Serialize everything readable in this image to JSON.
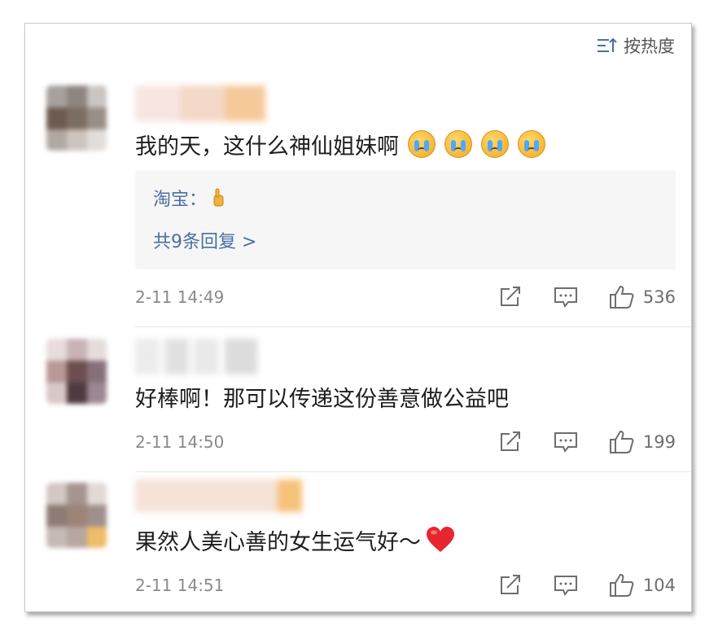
{
  "header": {
    "sort_label": "按热度"
  },
  "comments": [
    {
      "text": "我的天，这什么神仙姐妹啊",
      "emoji_count": 4,
      "replies": {
        "first_reply_user": "淘宝：",
        "more_label": "共9条回复 >"
      },
      "time": "2-11 14:49",
      "likes": "536"
    },
    {
      "text": "好棒啊！那可以传递这份善意做公益吧",
      "time": "2-11 14:50",
      "likes": "199"
    },
    {
      "text": "果然人美心善的女生运气好～",
      "time": "2-11 14:51",
      "likes": "104"
    }
  ],
  "colors": {
    "link": "#4a6fa0",
    "meta": "#8a8a8a",
    "heart": "#e8262f"
  }
}
